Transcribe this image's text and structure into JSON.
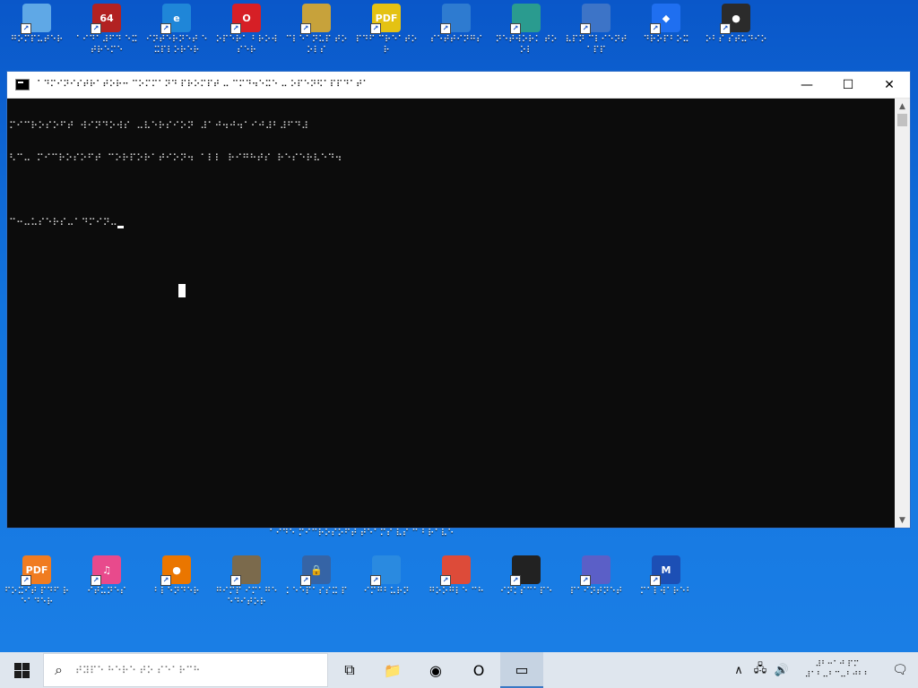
{
  "desktop": {
    "top_icons": [
      {
        "label": "⠛⠕⠍⠏⠥⠞⠑⠗",
        "icon": "computer-icon",
        "color": "#5fa8e6",
        "text": ""
      },
      {
        "label": "⠁⠊⠙⠁⠼⠋⠙ ⠑⠭⠞⠗⠑⠍⠑",
        "icon": "aida64-icon",
        "color": "#b22222",
        "text": "64"
      },
      {
        "label": "⠊⠝⠞⠑⠗⠝⠑⠞ ⠑⠭⠏⠇⠕⠗⠑⠗",
        "icon": "internet-explorer-icon",
        "color": "#1f86d8",
        "text": "e"
      },
      {
        "label": "⠕⠏⠑⠗⠁ ⠃⠗⠕⠺⠎⠑⠗",
        "icon": "opera-icon",
        "color": "#d61f26",
        "text": "O"
      },
      {
        "label": "⠉⠇⠑⠁⠝⠥⠏ ⠞⠕⠕⠇⠎",
        "icon": "cleanup-disc-icon",
        "color": "#c7a23b",
        "text": ""
      },
      {
        "label": "⠏⠙⠋ ⠉⠗⠑⠁⠞⠕⠗",
        "icon": "pdf-icon",
        "color": "#e4c213",
        "text": "PDF"
      },
      {
        "label": "⠎⠑⠞⠞⠊⠝⠛⠎",
        "icon": "settings-shield-icon",
        "color": "#2e7bd0",
        "text": ""
      },
      {
        "label": "⠝⠑⠞⠺⠕⠗⠅ ⠞⠕⠕⠇",
        "icon": "network-tool-icon",
        "color": "#2a9b8f",
        "text": ""
      },
      {
        "label": "⠧⠏⠝ ⠉⠇⠊⠑⠝⠞ ⠁⠏⠏",
        "icon": "vpn-globe-icon",
        "color": "#3d74c7",
        "text": ""
      },
      {
        "label": "⠙⠗⠕⠏⠃⠕⠭",
        "icon": "dropbox-icon",
        "color": "#1f6ff0",
        "text": "◆"
      },
      {
        "label": "⠕⠃⠎ ⠎⠞⠥⠙⠊⠕",
        "icon": "obs-icon",
        "color": "#2b2b2b",
        "text": "●"
      }
    ],
    "bottom_icons": [
      {
        "label": "⠋⠕⠭⠊⠞ ⠏⠙⠋ ⠗⠑⠁⠙⠑⠗",
        "icon": "foxit-pdf-icon",
        "color": "#f07c21",
        "text": "PDF"
      },
      {
        "label": "⠊⠞⠥⠝⠑⠎",
        "icon": "itunes-icon",
        "color": "#e84a8c",
        "text": "♫"
      },
      {
        "label": "⠃⠇⠑⠝⠙⠑⠗",
        "icon": "blender-icon",
        "color": "#ea7600",
        "text": "●"
      },
      {
        "label": "⠛⠊⠍⠏ ⠊⠍⠁⠛⠑ ⠑⠙⠊⠞⠕⠗",
        "icon": "gimp-icon",
        "color": "#7b6a4c",
        "text": ""
      },
      {
        "label": "⠅⠑⠑⠏⠁⠎⠎⠭ ⠏",
        "icon": "keepass-icon",
        "color": "#3564a6",
        "text": "🔒"
      },
      {
        "label": "⠊⠍⠛⠃⠥⠗⠝",
        "icon": "disc-burn-icon",
        "color": "#2a8ae0",
        "text": ""
      },
      {
        "label": "⠛⠕⠕⠛⠇⠑ ⠉⠓",
        "icon": "chrome-icon",
        "color": "#dd4b39",
        "text": ""
      },
      {
        "label": "⠊⠝⠅⠎⠉⠁⠏⠑",
        "icon": "inkscape-icon",
        "color": "#222",
        "text": ""
      },
      {
        "label": "⠏⠁⠊⠝⠞⠝⠑⠞",
        "icon": "paint-icon",
        "color": "#5b5fc7",
        "text": ""
      },
      {
        "label": "⠍⠁⠇⠺⠁⠗⠑⠃",
        "icon": "malwarebytes-icon",
        "color": "#1c4fb5",
        "text": "M"
      }
    ],
    "partial_labels": "⠁⠊⠙⠑    ⠍⠊⠉⠗⠕⠎⠕⠋⠞ ⠞⠑⠁⠍⠎   ⠧⠎ ⠉   ⠃⠗⠁⠧⠑"
  },
  "cmd_window": {
    "title": "⠁⠙⠍⠊⠝⠊⠎⠞⠗⠁⠞⠕⠗⠒ ⠉⠕⠍⠍⠁⠝⠙ ⠏⠗⠕⠍⠏⠞ ⠤ ⠉⠍⠙⠲⠑⠭⠑ ⠤ ⠕⠏⠑⠝⠫⠁⠏⠏⠙⠁⠞⠁",
    "controls": {
      "minimize": "—",
      "maximize": "☐",
      "close": "✕"
    },
    "lines": [
      "⠍⠊⠉⠗⠕⠎⠕⠋⠞ ⠺⠊⠝⠙⠕⠺⠎ ⠤⠧⠑⠗⠎⠊⠕⠝ ⠼⠁⠚⠲⠚⠲⠁⠊⠚⠼⠃⠼⠋⠙⠼",
      "⠣⠉⠤ ⠍⠊⠉⠗⠕⠎⠕⠋⠞ ⠉⠕⠗⠏⠕⠗⠁⠞⠊⠕⠝⠲ ⠁⠇⠇ ⠗⠊⠛⠓⠞⠎ ⠗⠑⠎⠑⠗⠧⠑⠙⠲",
      "",
      "⠉⠒⠤⠥⠎⠑⠗⠎⠤⠁⠙⠍⠊⠝⠤"
    ]
  },
  "taskbar": {
    "search_placeholder": "⠞⠽⠏⠑ ⠓⠑⠗⠑ ⠞⠕ ⠎⠑⠁⠗⠉⠓",
    "apps": [
      {
        "icon": "task-view-icon",
        "glyph": "⧉",
        "active": false
      },
      {
        "icon": "file-explorer-icon",
        "glyph": "📁",
        "active": false
      },
      {
        "icon": "chrome-icon",
        "glyph": "◉",
        "active": false
      },
      {
        "icon": "opera-icon",
        "glyph": "O",
        "active": false
      },
      {
        "icon": "command-prompt-icon",
        "glyph": "▭",
        "active": true
      }
    ],
    "tray": {
      "chevron": "∧",
      "network": "🖧",
      "volume": "🔊",
      "time": "⠼⠃⠒⠁⠚ ⠏⠍",
      "date": "⠼⠁⠃⠤⠃⠉⠤⠃⠚⠃⠃",
      "notifications": "🗨"
    }
  }
}
